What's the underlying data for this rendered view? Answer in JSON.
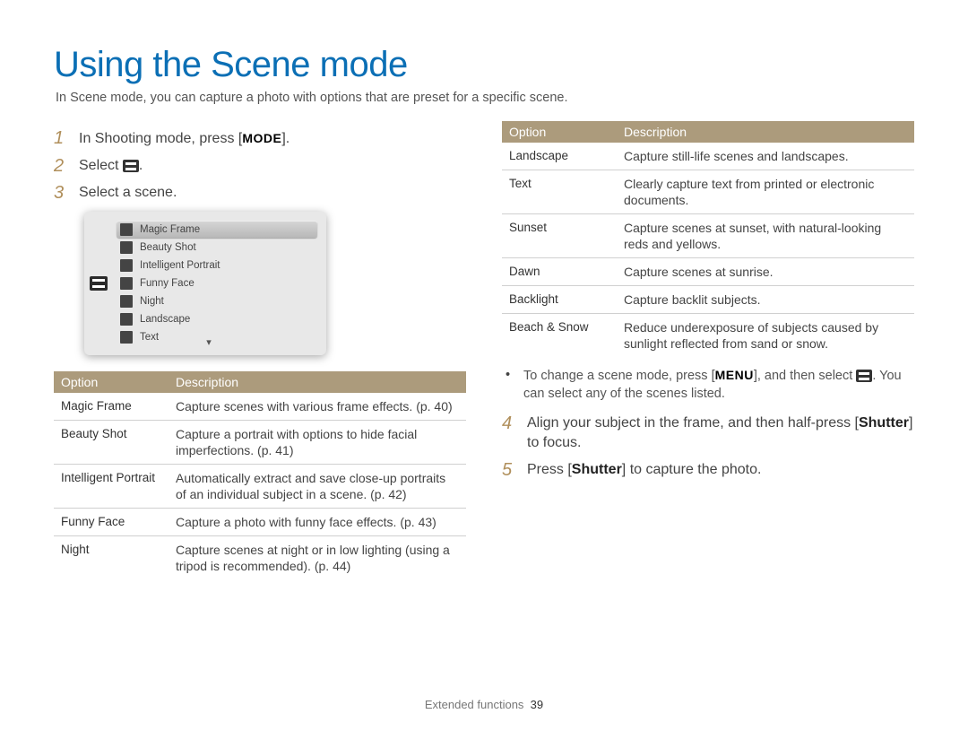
{
  "title": "Using the Scene mode",
  "intro": "In Scene mode, you can capture a photo with options that are preset for a specific scene.",
  "steps": {
    "s1": {
      "num": "1",
      "pre": "In Shooting mode, press [",
      "btn": "MODE",
      "post": "]."
    },
    "s2": {
      "num": "2",
      "text": "Select ",
      "post": "."
    },
    "s3": {
      "num": "3",
      "text": "Select a scene."
    },
    "s4": {
      "num": "4",
      "text_pre": "Align your subject in the frame, and then half-press [",
      "bold": "Shutter",
      "text_post": "] to focus."
    },
    "s5": {
      "num": "5",
      "text_pre": "Press [",
      "bold": "Shutter",
      "text_post": "] to capture the photo."
    }
  },
  "scene_list": {
    "items": [
      {
        "label": "Magic Frame",
        "selected": true
      },
      {
        "label": "Beauty Shot"
      },
      {
        "label": "Intelligent Portrait"
      },
      {
        "label": "Funny Face"
      },
      {
        "label": "Night"
      },
      {
        "label": "Landscape"
      },
      {
        "label": "Text"
      }
    ]
  },
  "table1": {
    "headers": {
      "option": "Option",
      "desc": "Description"
    },
    "rows": [
      {
        "option": "Magic Frame",
        "desc": "Capture scenes with various frame effects. (p. 40)"
      },
      {
        "option": "Beauty Shot",
        "desc": "Capture a portrait with options to hide facial imperfections. (p. 41)"
      },
      {
        "option": "Intelligent Portrait",
        "desc": "Automatically extract and save close-up portraits of an individual subject in a scene. (p. 42)"
      },
      {
        "option": "Funny Face",
        "desc": "Capture a photo with funny face effects. (p. 43)"
      },
      {
        "option": "Night",
        "desc": "Capture scenes at night or in low lighting (using a tripod is recommended). (p. 44)"
      }
    ]
  },
  "table2": {
    "headers": {
      "option": "Option",
      "desc": "Description"
    },
    "rows": [
      {
        "option": "Landscape",
        "desc": "Capture still-life scenes and landscapes."
      },
      {
        "option": "Text",
        "desc": "Clearly capture text from printed or electronic documents."
      },
      {
        "option": "Sunset",
        "desc": "Capture scenes at sunset, with natural-looking reds and yellows."
      },
      {
        "option": "Dawn",
        "desc": "Capture scenes at sunrise."
      },
      {
        "option": "Backlight",
        "desc": "Capture backlit subjects."
      },
      {
        "option": "Beach & Snow",
        "desc": "Reduce underexposure of subjects caused by sunlight reflected from sand or snow."
      }
    ]
  },
  "tip": {
    "pre": "To change a scene mode, press [",
    "btn": "MENU",
    "mid": "], and then select ",
    "post": ". You can select any of the scenes listed."
  },
  "footer": {
    "section": "Extended functions",
    "page": "39"
  }
}
